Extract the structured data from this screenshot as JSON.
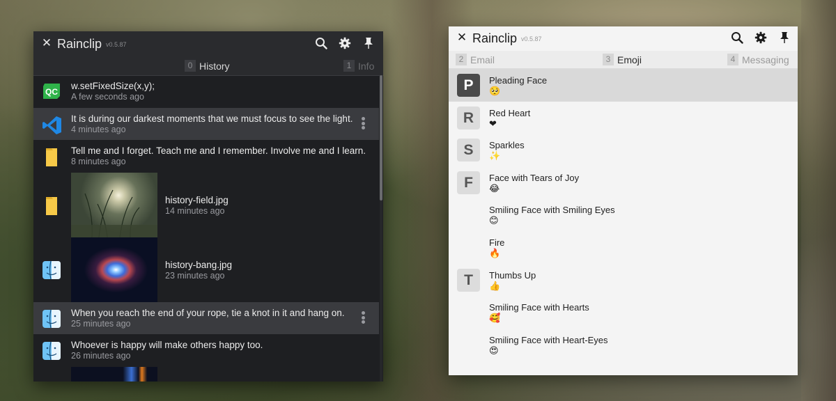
{
  "colors": {
    "dark_bg": "#1e1f22",
    "dark_selected": "#3a3b3f",
    "light_bg": "#f4f4f4",
    "light_selected": "#d9d9d9",
    "qt_green": "#2fb34a",
    "vscode_blue": "#1f88e5",
    "folder_yellow": "#f7c948"
  },
  "left_window": {
    "close_label": "✕",
    "title": "Rainclip",
    "version": "v0.5.87",
    "tabs": [
      {
        "num": "0",
        "label": "History"
      },
      {
        "num": "1",
        "label": "Info"
      }
    ],
    "items": [
      {
        "icon": "qt-creator-icon",
        "title": "w.setFixedSize(x,y);",
        "time": "A few seconds ago"
      },
      {
        "icon": "vscode-icon",
        "title": "It is during our darkest moments that we must focus to see the light.",
        "time": "4 minutes ago"
      },
      {
        "icon": "folder-icon",
        "title": "Tell me and I forget. Teach me and I remember. Involve me and I learn.",
        "time": "8 minutes ago"
      },
      {
        "icon": "folder-icon",
        "title": "history-field.jpg",
        "time": "14 minutes ago"
      },
      {
        "icon": "finder-icon",
        "title": "history-bang.jpg",
        "time": "23 minutes ago"
      },
      {
        "icon": "finder-icon",
        "title": "When you reach the end of your rope, tie a knot in it and hang on.",
        "time": "25 minutes ago"
      },
      {
        "icon": "finder-icon",
        "title": "Whoever is happy will make others happy too.",
        "time": "26 minutes ago"
      }
    ]
  },
  "right_window": {
    "close_label": "✕",
    "title": "Rainclip",
    "version": "v0.5.87",
    "tabs": [
      {
        "num": "2",
        "label": "Email"
      },
      {
        "num": "3",
        "label": "Emoji"
      },
      {
        "num": "4",
        "label": "Messaging"
      }
    ],
    "items": [
      {
        "letter": "P",
        "name": "Pleading Face",
        "emoji": "🥺"
      },
      {
        "letter": "R",
        "name": "Red Heart",
        "emoji": "❤"
      },
      {
        "letter": "S",
        "name": "Sparkles",
        "emoji": "✨"
      },
      {
        "letter": "F",
        "name": "Face with Tears of Joy",
        "emoji": "😂"
      },
      {
        "letter": "",
        "name": "Smiling Face with Smiling Eyes",
        "emoji": "😊"
      },
      {
        "letter": "",
        "name": "Fire",
        "emoji": "🔥"
      },
      {
        "letter": "T",
        "name": "Thumbs Up",
        "emoji": "👍"
      },
      {
        "letter": "",
        "name": "Smiling Face with Hearts",
        "emoji": "🥰"
      },
      {
        "letter": "",
        "name": "Smiling Face with Heart-Eyes",
        "emoji": "😍"
      }
    ]
  }
}
